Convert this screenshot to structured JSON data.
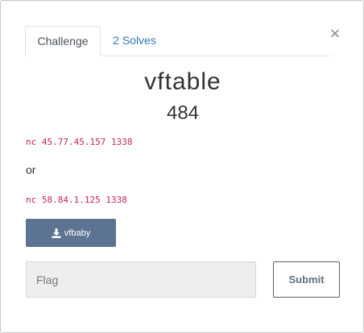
{
  "modal": {
    "close_glyph": "×",
    "tabs": [
      {
        "label": "Challenge",
        "active": true
      },
      {
        "label": "2 Solves",
        "active": false
      }
    ],
    "title": "vftable",
    "value": "484",
    "description": {
      "code1": "nc 45.77.45.157 1338",
      "or_text": "or",
      "code2": "nc 58.84.1.125 1338"
    },
    "download": {
      "label": "vfbaby",
      "icon": "download-icon"
    },
    "flag": {
      "placeholder": "Flag",
      "value": ""
    },
    "submit_label": "Submit"
  },
  "colors": {
    "tab_link": "#337ab7",
    "code": "#c7254e",
    "download_bg": "#5c7392",
    "input_bg": "#eeeeee"
  }
}
